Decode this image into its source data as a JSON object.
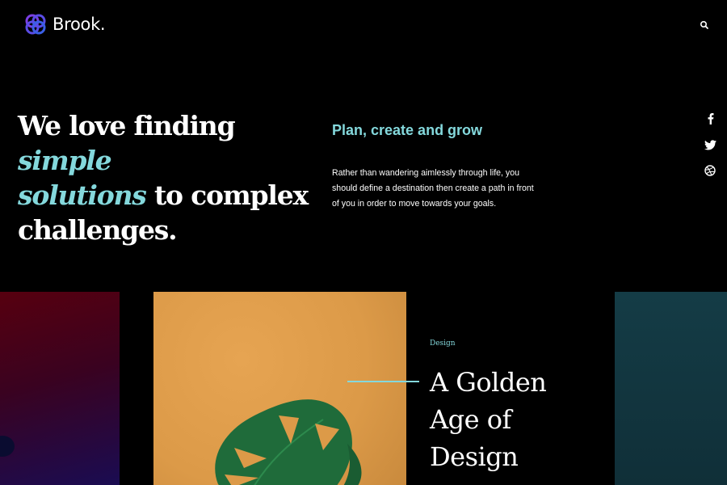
{
  "brand": {
    "name": "Brook.",
    "accent": "#84d8dc",
    "logo_colors": [
      "#7b3fe4",
      "#3a5fe6"
    ]
  },
  "header": {
    "search_icon": "search-icon"
  },
  "hero": {
    "headline_part1": "We love finding ",
    "headline_em1": "simple",
    "headline_em2": "solutions",
    "headline_part2": " to complex challenges.",
    "subheading": "Plan, create and grow",
    "description": "Rather than wandering aimlessly through life, you should define a destination then create a path in front of you in order to move towards your goals."
  },
  "social": [
    {
      "icon": "facebook-icon"
    },
    {
      "icon": "twitter-icon"
    },
    {
      "icon": "dribbble-icon"
    }
  ],
  "featured": {
    "category": "Design",
    "title": "A Golden Age of Design",
    "colors": {
      "left": "#4a0018",
      "main": "#e09e4c",
      "right": "#133a44",
      "leaf": "#1f6b3a"
    }
  }
}
